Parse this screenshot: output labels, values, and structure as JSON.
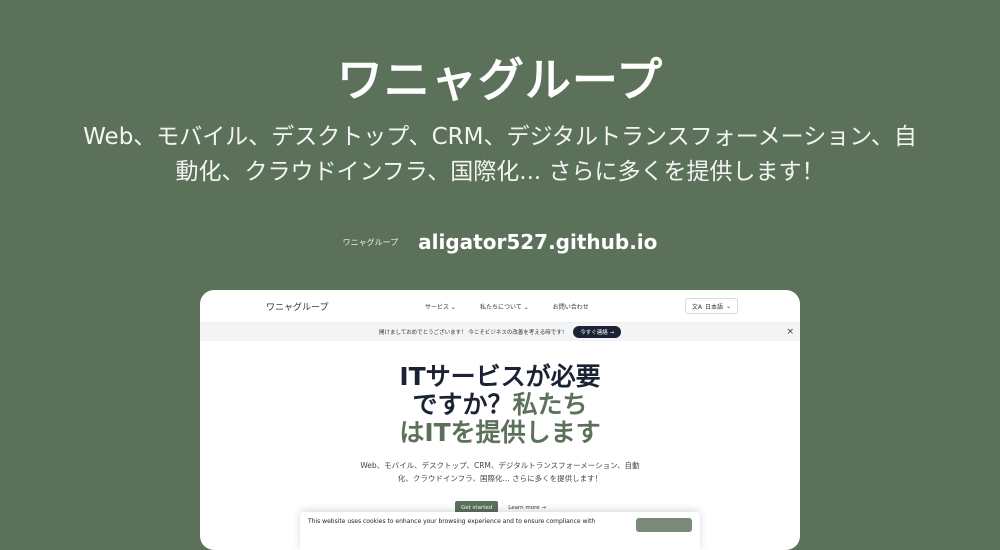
{
  "header": {
    "title": "ワニャグループ",
    "subtitle": "Web、モバイル、デスクトップ、CRM、デジタルトランスフォーメーション、自動化、クラウドインフラ、国際化... さらに多くを提供します！"
  },
  "site": {
    "logo_text": "ワニャグループ",
    "url": "aligator527.github.io"
  },
  "preview": {
    "brand": "ワニャグループ",
    "nav": {
      "services": "サービス",
      "about": "私たちについて",
      "contact": "お問い合わせ"
    },
    "language": {
      "icon": "translate-icon",
      "label": "日本語"
    },
    "banner": {
      "text": "開けましておめでとうございます！ 今こそビジネスの改善を考える時です！",
      "cta": "今すぐ連絡 →"
    },
    "hero": {
      "line1": "ITサービスが必要",
      "line2a": "ですか？",
      "line2b": "私たち",
      "line3": "はITを提供します"
    },
    "hero_sub": "Web、モバイル、デスクトップ、CRM、デジタルトランスフォーメーション、自動化、クラウドインフラ、国際化... さらに多くを提供します！",
    "buttons": {
      "primary": "Get started",
      "secondary": "Learn more →"
    },
    "cookie": {
      "text": "This website uses cookies to enhance your browsing experience and to ensure compliance with"
    }
  },
  "colors": {
    "background": "#5b7159",
    "dark": "#1b2233",
    "accent": "#5b7159"
  }
}
